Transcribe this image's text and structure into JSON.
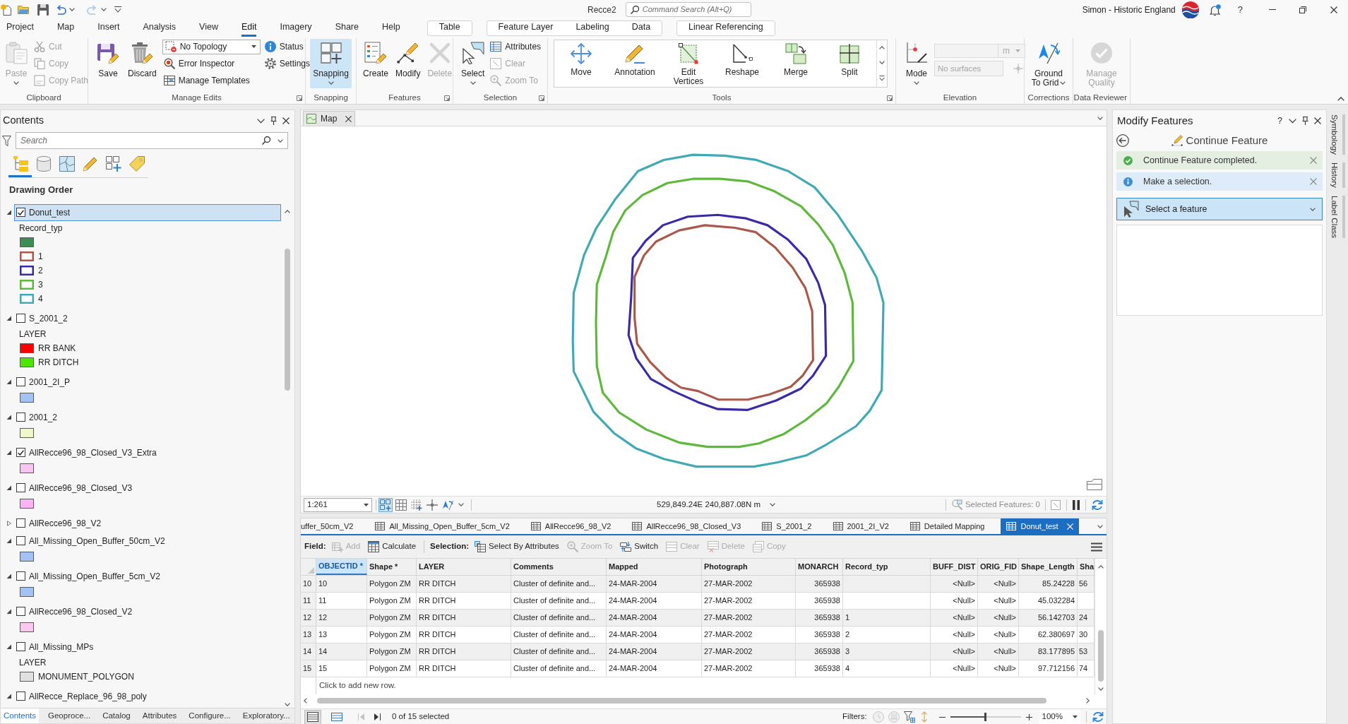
{
  "title_bar": {
    "project_name": "Recce2",
    "command_search": {
      "placeholder": "Command Search (Alt+Q)"
    },
    "user": "Simon - Historic England",
    "help": "?"
  },
  "ribbon_tabs": [
    {
      "label": "Project",
      "selected": false
    },
    {
      "label": "Map",
      "selected": false
    },
    {
      "label": "Insert",
      "selected": false
    },
    {
      "label": "Analysis",
      "selected": false
    },
    {
      "label": "View",
      "selected": false
    },
    {
      "label": "Edit",
      "selected": true
    },
    {
      "label": "Imagery",
      "selected": false
    },
    {
      "label": "Share",
      "selected": false
    },
    {
      "label": "Help",
      "selected": false
    }
  ],
  "contextual_tab_groups": [
    {
      "tabs": [
        {
          "label": "Table",
          "selected": false
        }
      ]
    },
    {
      "tabs": [
        {
          "label": "Feature Layer",
          "selected": false
        },
        {
          "label": "Labeling",
          "selected": false
        },
        {
          "label": "Data",
          "selected": false
        }
      ]
    },
    {
      "tabs": [
        {
          "label": "Linear Referencing",
          "selected": false
        }
      ]
    }
  ],
  "ribbon_groups": [
    {
      "label": "Clipboard",
      "dialog_launcher": false,
      "controls": [
        {
          "kind": "large",
          "label": "Paste",
          "disabled": true,
          "dropdown": true
        },
        {
          "kind": "small",
          "label": "Cut",
          "disabled": true
        },
        {
          "kind": "small",
          "label": "Copy",
          "disabled": true
        },
        {
          "kind": "small",
          "label": "Copy Path",
          "disabled": true
        }
      ]
    },
    {
      "label": "Manage Edits",
      "dialog_launcher": true,
      "controls": [
        {
          "kind": "large",
          "label": "Save",
          "disabled": false,
          "dropdown": false
        },
        {
          "kind": "large",
          "label": "Discard",
          "disabled": false,
          "dropdown": false
        },
        {
          "kind": "dropdown",
          "value": "No Topology",
          "disabled": false
        },
        {
          "kind": "small",
          "label": "Error Inspector",
          "disabled": false
        },
        {
          "kind": "small",
          "label": "Manage Templates",
          "disabled": false
        },
        {
          "kind": "small",
          "label": "Status",
          "disabled": false
        },
        {
          "kind": "small",
          "label": "Settings",
          "disabled": false
        }
      ]
    },
    {
      "label": "Snapping",
      "dialog_launcher": false,
      "controls": [
        {
          "kind": "toggle",
          "label": "Snapping",
          "on": true,
          "disabled": false,
          "dropdown": true
        }
      ]
    },
    {
      "label": "Features",
      "dialog_launcher": true,
      "controls": [
        {
          "kind": "large",
          "label": "Create",
          "disabled": false,
          "dropdown": false
        },
        {
          "kind": "large",
          "label": "Modify",
          "disabled": false,
          "dropdown": false
        },
        {
          "kind": "large",
          "label": "Delete",
          "disabled": true,
          "dropdown": false
        }
      ]
    },
    {
      "label": "Selection",
      "dialog_launcher": true,
      "controls": [
        {
          "kind": "large",
          "label": "Select",
          "disabled": false,
          "dropdown": true
        },
        {
          "kind": "small",
          "label": "Attributes",
          "disabled": false
        },
        {
          "kind": "small",
          "label": "Clear",
          "disabled": true
        },
        {
          "kind": "small",
          "label": "Zoom To",
          "disabled": true
        }
      ]
    },
    {
      "label": "Tools",
      "dialog_launcher": true,
      "controls": [
        {
          "kind": "gallery",
          "items": [
            {
              "label": "Move"
            },
            {
              "label": "Annotation"
            },
            {
              "label": "Edit Vertices"
            },
            {
              "label": "Reshape"
            },
            {
              "label": "Merge"
            },
            {
              "label": "Split"
            }
          ]
        }
      ]
    },
    {
      "label": "Elevation",
      "dialog_launcher": false,
      "controls": [
        {
          "kind": "large",
          "label": "Mode",
          "disabled": false,
          "dropdown": true
        },
        {
          "kind": "unit_field",
          "unit": "m",
          "disabled": true
        },
        {
          "kind": "surface_field",
          "placeholder": "No surfaces",
          "disabled": true
        }
      ]
    },
    {
      "label": "Corrections",
      "dialog_launcher": false,
      "controls": [
        {
          "kind": "menubutton",
          "label": "Ground To Grid",
          "disabled": false,
          "dropdown": true
        }
      ]
    },
    {
      "label": "Data Reviewer",
      "dialog_launcher": false,
      "controls": [
        {
          "kind": "large",
          "label": "Manage Quality",
          "disabled": true,
          "dropdown": false
        }
      ]
    }
  ],
  "contents": {
    "title": "Contents",
    "search": {
      "placeholder": "Search"
    },
    "view_tabs": [
      {
        "selected": true
      },
      {
        "selected": false
      },
      {
        "selected": false
      },
      {
        "selected": false
      },
      {
        "selected": false
      },
      {
        "selected": false
      }
    ],
    "heading": "Drawing Order",
    "layers": [
      {
        "name": "Donut_test",
        "checked": true,
        "expanded": true,
        "selected": true,
        "legend": {
          "heading": "Record_typ",
          "items": [
            {
              "kind": "fill",
              "color": "#3d8c53"
            },
            {
              "kind": "outline",
              "label": "1",
              "color": "#a8594a"
            },
            {
              "kind": "outline",
              "label": "2",
              "color": "#3a2aa6"
            },
            {
              "kind": "outline",
              "label": "3",
              "color": "#5db83b"
            },
            {
              "kind": "outline",
              "label": "4",
              "color": "#3fa9b5"
            }
          ]
        }
      },
      {
        "name": "S_2001_2",
        "checked": false,
        "expanded": true,
        "selected": false,
        "legend": {
          "heading": "LAYER",
          "items": [
            {
              "kind": "fill",
              "label": "RR BANK",
              "color": "#ff0000"
            },
            {
              "kind": "fill",
              "label": "RR DITCH",
              "color": "#4ce600"
            }
          ]
        }
      },
      {
        "name": "2001_2I_P",
        "checked": false,
        "expanded": true,
        "selected": false,
        "legend": {
          "items": [
            {
              "kind": "fill",
              "color": "#a3c2f5"
            }
          ]
        }
      },
      {
        "name": "2001_2",
        "checked": false,
        "expanded": true,
        "selected": false,
        "legend": {
          "items": [
            {
              "kind": "fill",
              "color": "#f0f7c8"
            }
          ]
        }
      },
      {
        "name": "AllRecce96_98_Closed_V3_Extra",
        "checked": true,
        "expanded": true,
        "selected": false,
        "legend": {
          "items": [
            {
              "kind": "fill",
              "color": "#fac5f5"
            }
          ]
        }
      },
      {
        "name": "AllRecce96_98_Closed_V3",
        "checked": false,
        "expanded": true,
        "selected": false,
        "legend": {
          "items": [
            {
              "kind": "fill",
              "color": "#fab4f5"
            }
          ]
        }
      },
      {
        "name": "AllRecce96_98_V2",
        "checked": false,
        "expanded": false,
        "selected": false
      },
      {
        "name": "All_Missing_Open_Buffer_50cm_V2",
        "checked": false,
        "expanded": true,
        "selected": false,
        "legend": {
          "items": [
            {
              "kind": "fill",
              "color": "#a3c2f5"
            }
          ]
        }
      },
      {
        "name": "All_Missing_Open_Buffer_5cm_V2",
        "checked": false,
        "expanded": true,
        "selected": false,
        "legend": {
          "items": [
            {
              "kind": "fill",
              "color": "#a3c2f5"
            }
          ]
        }
      },
      {
        "name": "AllRecce96_98_Closed_V2",
        "checked": false,
        "expanded": true,
        "selected": false,
        "legend": {
          "items": [
            {
              "kind": "fill",
              "color": "#fcc8f2"
            }
          ]
        }
      },
      {
        "name": "All_Missing_MPs",
        "checked": false,
        "expanded": true,
        "selected": false,
        "legend": {
          "heading": "LAYER",
          "items": [
            {
              "kind": "fill",
              "label": "MONUMENT_POLYGON",
              "color": "#e1e1e1"
            }
          ]
        }
      },
      {
        "name": "AllRecce_Replace_96_98_poly",
        "checked": false,
        "expanded": true,
        "selected": false
      }
    ],
    "bottom_tabs": [
      {
        "label": "Contents",
        "selected": true
      },
      {
        "label": "Geoproce...",
        "selected": false
      },
      {
        "label": "Catalog",
        "selected": false
      },
      {
        "label": "Attributes",
        "selected": false
      },
      {
        "label": "Configure...",
        "selected": false
      },
      {
        "label": "Exploratory...",
        "selected": false
      }
    ]
  },
  "map": {
    "tab": "Map",
    "scale": "1:261",
    "tools": [
      {
        "selected": true
      },
      {
        "selected": false
      },
      {
        "selected": false
      },
      {
        "selected": false
      },
      {
        "selected": false
      }
    ],
    "coordinates": "529,849.24E 240,887.08N m",
    "selected_features": "Selected Features: 0"
  },
  "table_tabs": {
    "partial_tab": "uffer_50cm_V2",
    "tabs": [
      {
        "label": "All_Missing_Open_Buffer_5cm_V2",
        "selected": false
      },
      {
        "label": "AllRecce96_98_V2",
        "selected": false
      },
      {
        "label": "AllRecce96_98_Closed_V3",
        "selected": false
      },
      {
        "label": "S_2001_2",
        "selected": false
      },
      {
        "label": "2001_2I_V2",
        "selected": false
      },
      {
        "label": "Detailed Mapping",
        "selected": false
      },
      {
        "label": "Donut_test",
        "selected": true
      }
    ]
  },
  "table_toolbar": {
    "field_label": "Field:",
    "field_buttons": [
      {
        "label": "Add",
        "disabled": true
      },
      {
        "label": "Calculate",
        "disabled": false
      }
    ],
    "selection_label": "Selection:",
    "selection_buttons": [
      {
        "label": "Select By Attributes",
        "disabled": false
      },
      {
        "label": "Zoom To",
        "disabled": true
      },
      {
        "label": "Switch",
        "disabled": false
      },
      {
        "label": "Clear",
        "disabled": true
      },
      {
        "label": "Delete",
        "disabled": true
      },
      {
        "label": "Copy",
        "disabled": true
      }
    ]
  },
  "table": {
    "columns": [
      {
        "label": "OBJECTID *",
        "kind": "text",
        "selected": true
      },
      {
        "label": "Shape *",
        "kind": "text",
        "selected": false
      },
      {
        "label": "LAYER",
        "kind": "text",
        "selected": false
      },
      {
        "label": "Comments",
        "kind": "text",
        "selected": false
      },
      {
        "label": "Mapped",
        "kind": "text",
        "selected": false
      },
      {
        "label": "Photograph",
        "kind": "text",
        "selected": false
      },
      {
        "label": "MONARCH",
        "kind": "number",
        "selected": false
      },
      {
        "label": "Record_typ",
        "kind": "text",
        "selected": false
      },
      {
        "label": "BUFF_DIST",
        "kind": "number",
        "selected": false
      },
      {
        "label": "ORIG_FID",
        "kind": "number",
        "selected": false
      },
      {
        "label": "Shape_Length",
        "kind": "number",
        "selected": false
      },
      {
        "label": "Sha",
        "kind": "clipped",
        "selected": false
      }
    ],
    "rows": [
      {
        "number": "10",
        "cells": [
          "10",
          "Polygon ZM",
          "RR DITCH",
          "Cluster of definite and...",
          "24-MAR-2004",
          "27-MAR-2002",
          "365938",
          null,
          "<Null>",
          "<Null>",
          "85.24228",
          "56"
        ]
      },
      {
        "number": "11",
        "cells": [
          "11",
          "Polygon ZM",
          "RR DITCH",
          "Cluster of definite and...",
          "24-MAR-2004",
          "27-MAR-2002",
          "365938",
          null,
          "<Null>",
          "<Null>",
          "45.032284",
          null
        ]
      },
      {
        "number": "12",
        "cells": [
          "12",
          "Polygon ZM",
          "RR DITCH",
          "Cluster of definite and...",
          "24-MAR-2004",
          "27-MAR-2002",
          "365938",
          "1",
          "<Null>",
          "<Null>",
          "56.142703",
          "24"
        ]
      },
      {
        "number": "13",
        "cells": [
          "13",
          "Polygon ZM",
          "RR DITCH",
          "Cluster of definite and...",
          "24-MAR-2004",
          "27-MAR-2002",
          "365938",
          "2",
          "<Null>",
          "<Null>",
          "62.380697",
          "30"
        ]
      },
      {
        "number": "14",
        "cells": [
          "14",
          "Polygon ZM",
          "RR DITCH",
          "Cluster of definite and...",
          "24-MAR-2004",
          "27-MAR-2002",
          "365938",
          "3",
          "<Null>",
          "<Null>",
          "83.177895",
          "53"
        ]
      },
      {
        "number": "15",
        "cells": [
          "15",
          "Polygon ZM",
          "RR DITCH",
          "Cluster of definite and...",
          "24-MAR-2004",
          "27-MAR-2002",
          "365938",
          "4",
          "<Null>",
          "<Null>",
          "97.712156",
          "74"
        ]
      }
    ],
    "new_row": "Click to add new row."
  },
  "table_status": {
    "view_buttons": [
      {
        "selected": true
      },
      {
        "selected": false
      }
    ],
    "selection": "0 of 15 selected",
    "filters_label": "Filters:",
    "zoom_slider": {
      "level": 0.5
    },
    "zoom": "100%"
  },
  "modify_features": {
    "title": "Modify Features",
    "help": "?",
    "tool": "Continue Feature",
    "messages": [
      {
        "kind": "success",
        "text": "Continue Feature completed."
      },
      {
        "kind": "info",
        "text": "Make a selection."
      }
    ],
    "selector": "Select a feature"
  },
  "side_tabs": [
    "Symbology",
    "History",
    "Label Class"
  ]
}
